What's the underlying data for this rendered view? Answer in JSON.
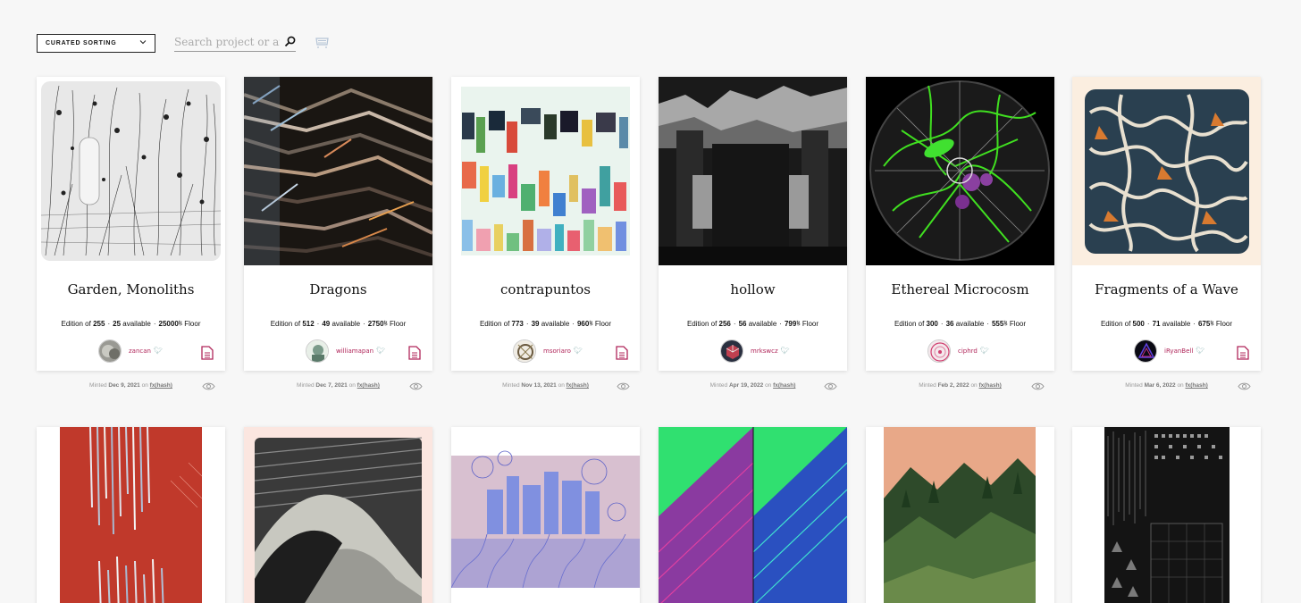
{
  "toolbar": {
    "sort_label": "CURATED SORTING",
    "search_placeholder": "Search project or artist"
  },
  "cards": [
    {
      "title": "Garden, Monoliths",
      "edition": "255",
      "available": "25",
      "floor": "25000",
      "author": "zancan",
      "minted_date": "Dec 9, 2021"
    },
    {
      "title": "Dragons",
      "edition": "512",
      "available": "49",
      "floor": "2750",
      "author": "williamapan",
      "minted_date": "Dec 7, 2021"
    },
    {
      "title": "contrapuntos",
      "edition": "773",
      "available": "39",
      "floor": "960",
      "author": "msoriaro",
      "minted_date": "Nov 13, 2021"
    },
    {
      "title": "hollow",
      "edition": "256",
      "available": "56",
      "floor": "799",
      "author": "mrkswcz",
      "minted_date": "Apr 19, 2022"
    },
    {
      "title": "Ethereal Microcosm",
      "edition": "300",
      "available": "36",
      "floor": "555",
      "author": "ciphrd",
      "minted_date": "Feb 2, 2022"
    },
    {
      "title": "Fragments of a Wave",
      "edition": "500",
      "available": "71",
      "floor": "675",
      "author": "iRyanBell",
      "minted_date": "Mar 6, 2022"
    }
  ],
  "labels": {
    "edition_of": "Edition of",
    "available": "available",
    "floor": "Floor",
    "tezos_symbol": "ꜩ",
    "minted": "Minted",
    "on": "on",
    "platform": "fx(hash)",
    "separator": "·"
  },
  "colors": {
    "accent": "#b0265a",
    "background": "#f7f7f7"
  },
  "icons": {
    "sort_chevron": "chevron-down-icon",
    "search": "search-icon",
    "cart": "cart-icon",
    "twitter": "twitter-icon",
    "document": "document-icon",
    "eye": "eye-icon"
  }
}
